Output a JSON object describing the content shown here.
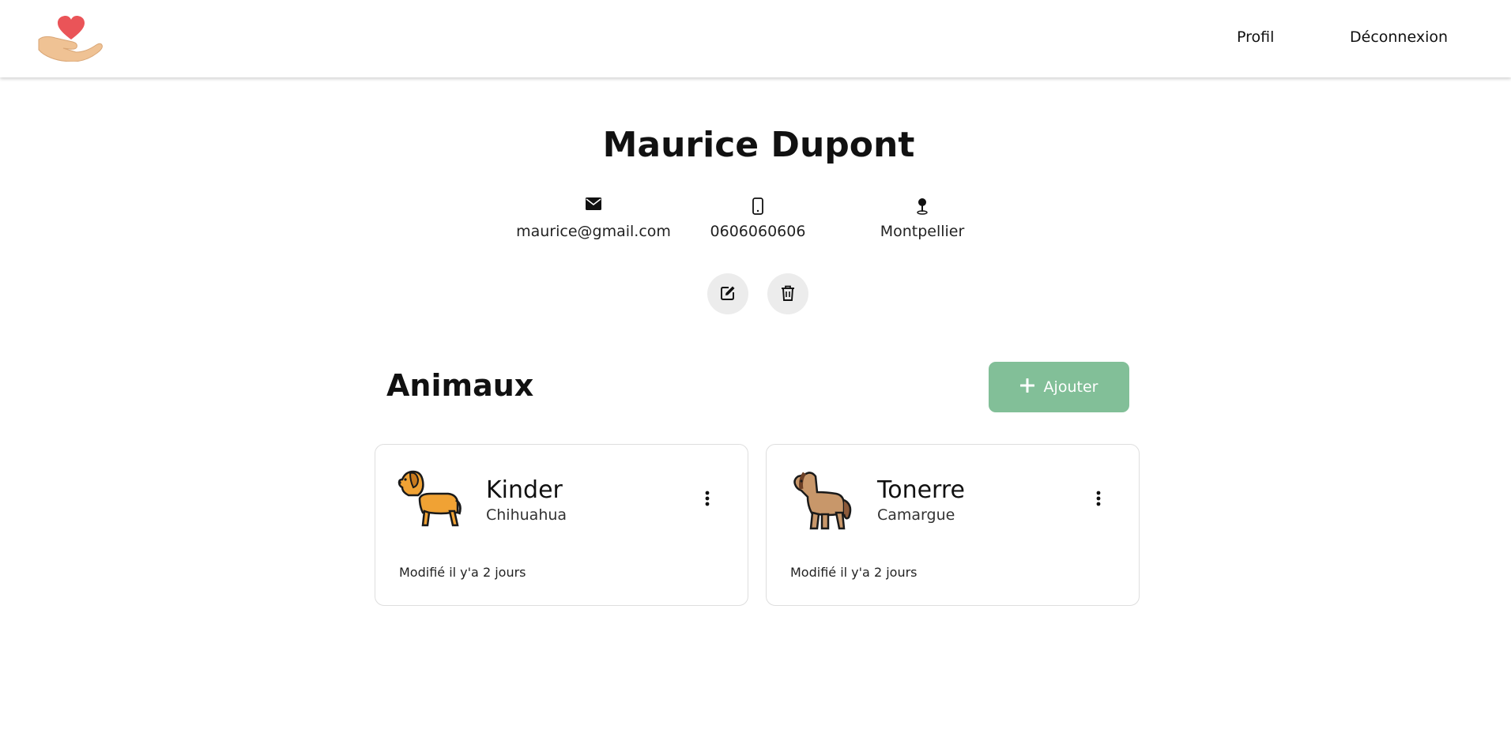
{
  "nav": {
    "logo_icon": "heart-in-hand-icon",
    "profile_label": "Profil",
    "logout_label": "Déconnexion"
  },
  "profile": {
    "name": "Maurice Dupont",
    "email": "maurice@gmail.com",
    "email_icon": "envelope-icon",
    "phone": "0606060606",
    "phone_icon": "phone-icon",
    "city": "Montpellier",
    "city_icon": "map-pin-icon",
    "edit_icon": "edit-icon",
    "delete_icon": "trash-icon"
  },
  "animals": {
    "title": "Animaux",
    "add_label": "Ajouter",
    "add_icon": "plus-icon",
    "accent_color": "#82bf98",
    "items": [
      {
        "name": "Kinder",
        "breed": "Chihuahua",
        "modified": "Modifié il y'a 2 jours",
        "icon": "dog-icon",
        "menu_icon": "kebab-menu-icon"
      },
      {
        "name": "Tonerre",
        "breed": "Camargue",
        "modified": "Modifié il y'a 2 jours",
        "icon": "horse-icon",
        "menu_icon": "kebab-menu-icon"
      }
    ]
  }
}
